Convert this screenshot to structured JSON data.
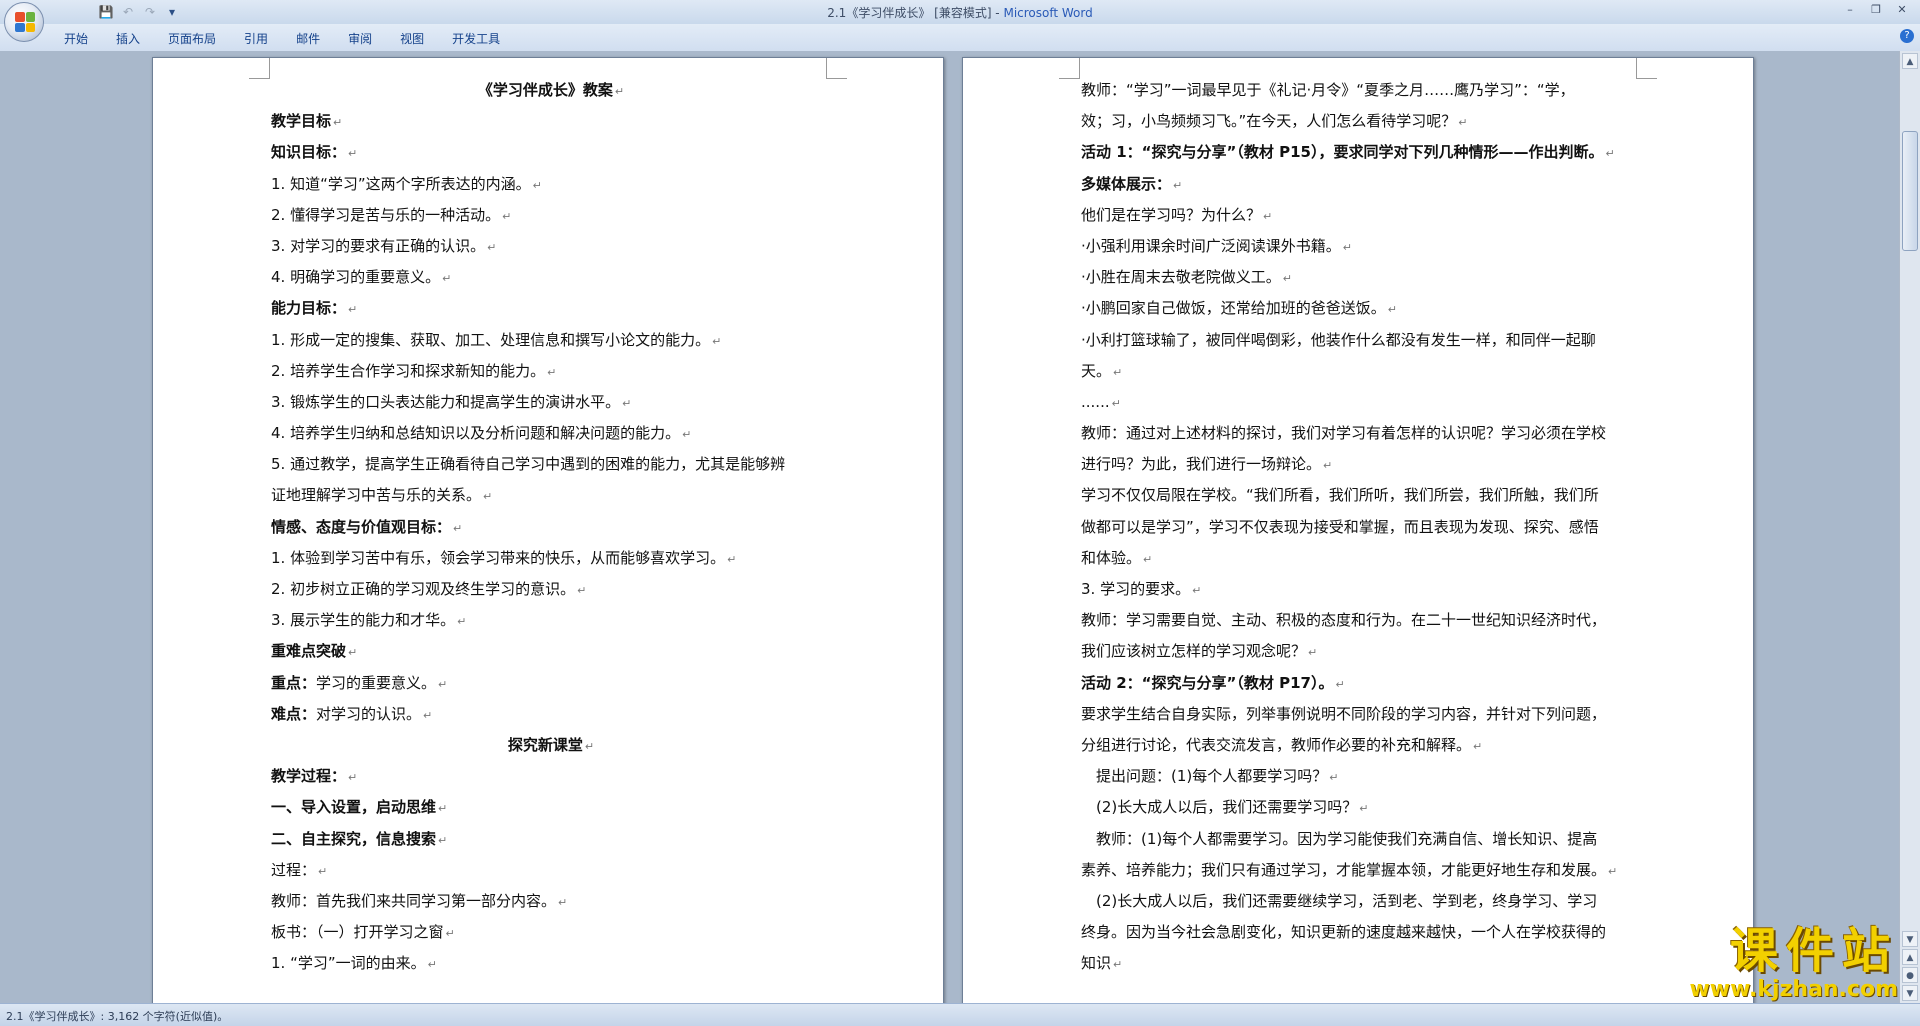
{
  "window": {
    "title_doc": "2.1《学习伴成长》 [兼容模式] - ",
    "title_app": "Microsoft Word"
  },
  "ribbon": {
    "tabs": [
      "开始",
      "插入",
      "页面布局",
      "引用",
      "邮件",
      "审阅",
      "视图",
      "开发工具"
    ]
  },
  "left_page": {
    "lines": [
      {
        "text": "《学习伴成长》教案",
        "style": "bold center"
      },
      {
        "text": "教学目标",
        "style": "bold"
      },
      {
        "text": "知识目标：",
        "style": "bold"
      },
      {
        "text": "1. 知道“学习”这两个字所表达的内涵。",
        "style": ""
      },
      {
        "text": "2. 懂得学习是苦与乐的一种活动。",
        "style": ""
      },
      {
        "text": "3. 对学习的要求有正确的认识。",
        "style": ""
      },
      {
        "text": "4. 明确学习的重要意义。",
        "style": ""
      },
      {
        "text": "能力目标：",
        "style": "bold"
      },
      {
        "text": "1. 形成一定的搜集、获取、加工、处理信息和撰写小论文的能力。",
        "style": ""
      },
      {
        "text": "2. 培养学生合作学习和探求新知的能力。",
        "style": ""
      },
      {
        "text": "3. 锻炼学生的口头表达能力和提高学生的演讲水平。",
        "style": ""
      },
      {
        "text": "4. 培养学生归纳和总结知识以及分析问题和解决问题的能力。",
        "style": ""
      },
      {
        "text": "5. 通过教学，提高学生正确看待自己学习中遇到的困难的能力，尤其是能够辨",
        "style": "",
        "nomark": true
      },
      {
        "text": "证地理解学习中苦与乐的关系。",
        "style": ""
      },
      {
        "text": "情感、态度与价值观目标：",
        "style": "bold"
      },
      {
        "text": "1. 体验到学习苦中有乐，领会学习带来的快乐，从而能够喜欢学习。",
        "style": ""
      },
      {
        "text": "2. 初步树立正确的学习观及终生学习的意识。",
        "style": ""
      },
      {
        "text": "3. 展示学生的能力和才华。",
        "style": ""
      },
      {
        "text": "重难点突破",
        "style": "bold"
      },
      {
        "text": "重点：学习的重要意义。",
        "style": "lead"
      },
      {
        "text": "难点：对学习的认识。",
        "style": "lead"
      },
      {
        "text": "探究新课堂",
        "style": "bold center"
      },
      {
        "text": "教学过程：",
        "style": "bold"
      },
      {
        "text": "一、导入设置，启动思维",
        "style": "bold"
      },
      {
        "text": "二、自主探究，信息搜索",
        "style": "bold"
      },
      {
        "text": "过程：",
        "style": ""
      },
      {
        "text": "教师：首先我们来共同学习第一部分内容。",
        "style": ""
      },
      {
        "text": "板书：（一）打开学习之窗",
        "style": ""
      },
      {
        "text": "1. “学习”一词的由来。",
        "style": ""
      }
    ]
  },
  "right_page": {
    "lines": [
      {
        "text": "教师：“学习”一词最早见于《礼记·月令》“夏季之月……鹰乃学习”：“学，",
        "style": "",
        "nomark": true
      },
      {
        "text": "效；习，小鸟频频习飞。”在今天，人们怎么看待学习呢？",
        "style": ""
      },
      {
        "text": "活动 1：“探究与分享”（教材 P15），要求同学对下列几种情形——作出判断。",
        "style": "bold"
      },
      {
        "text": "多媒体展示：",
        "style": "bold"
      },
      {
        "text": "他们是在学习吗？为什么？",
        "style": ""
      },
      {
        "text": "·小强利用课余时间广泛阅读课外书籍。",
        "style": ""
      },
      {
        "text": "·小胜在周末去敬老院做义工。",
        "style": ""
      },
      {
        "text": "·小鹏回家自己做饭，还常给加班的爸爸送饭。",
        "style": ""
      },
      {
        "text": "·小利打篮球输了，被同伴喝倒彩，他装作什么都没有发生一样，和同伴一起聊",
        "style": "",
        "nomark": true
      },
      {
        "text": "天。",
        "style": ""
      },
      {
        "text": "......",
        "style": ""
      },
      {
        "text": "教师：通过对上述材料的探讨，我们对学习有着怎样的认识呢？学习必须在学校",
        "style": "",
        "nomark": true
      },
      {
        "text": "进行吗？为此，我们进行一场辩论。",
        "style": ""
      },
      {
        "text": "学习不仅仅局限在学校。“我们所看，我们所听，我们所尝，我们所触，我们所",
        "style": "",
        "nomark": true
      },
      {
        "text": "做都可以是学习”，学习不仅表现为接受和掌握，而且表现为发现、探究、感悟",
        "style": "",
        "nomark": true
      },
      {
        "text": "和体验。",
        "style": ""
      },
      {
        "text": "3. 学习的要求。",
        "style": ""
      },
      {
        "text": "教师：学习需要自觉、主动、积极的态度和行为。在二十一世纪知识经济时代，",
        "style": "",
        "nomark": true
      },
      {
        "text": "我们应该树立怎样的学习观念呢？",
        "style": ""
      },
      {
        "text": "活动 2：“探究与分享”（教材 P17）。",
        "style": "bold"
      },
      {
        "text": "要求学生结合自身实际，列举事例说明不同阶段的学习内容，并针对下列问题，",
        "style": "",
        "nomark": true
      },
      {
        "text": "分组进行讨论，代表交流发言，教师作必要的补充和解释。",
        "style": ""
      },
      {
        "text": "　提出问题：(1)每个人都要学习吗？",
        "style": ""
      },
      {
        "text": "　(2)长大成人以后，我们还需要学习吗？",
        "style": ""
      },
      {
        "text": "　教师：(1)每个人都需要学习。因为学习能使我们充满自信、增长知识、提高",
        "style": "",
        "nomark": true
      },
      {
        "text": "素养、培养能力；我们只有通过学习，才能掌握本领，才能更好地生存和发展。",
        "style": ""
      },
      {
        "text": "　(2)长大成人以后，我们还需要继续学习，活到老、学到老，终身学习、学习",
        "style": "",
        "nomark": true
      },
      {
        "text": "终身。因为当今社会急剧变化，知识更新的速度越来越快，一个人在学校获得的",
        "style": "",
        "nomark": true
      },
      {
        "text": "知识",
        "style": ""
      }
    ]
  },
  "statusbar": {
    "text": "2.1《学习伴成长》: 3,162 个字符(近似值)。"
  },
  "watermark": {
    "title": "课件站",
    "url": "www.kjzhan.com"
  },
  "colors": {
    "background": "#a8b7ca",
    "ribbon": "#d1def0",
    "watermark": "#f2d000"
  }
}
